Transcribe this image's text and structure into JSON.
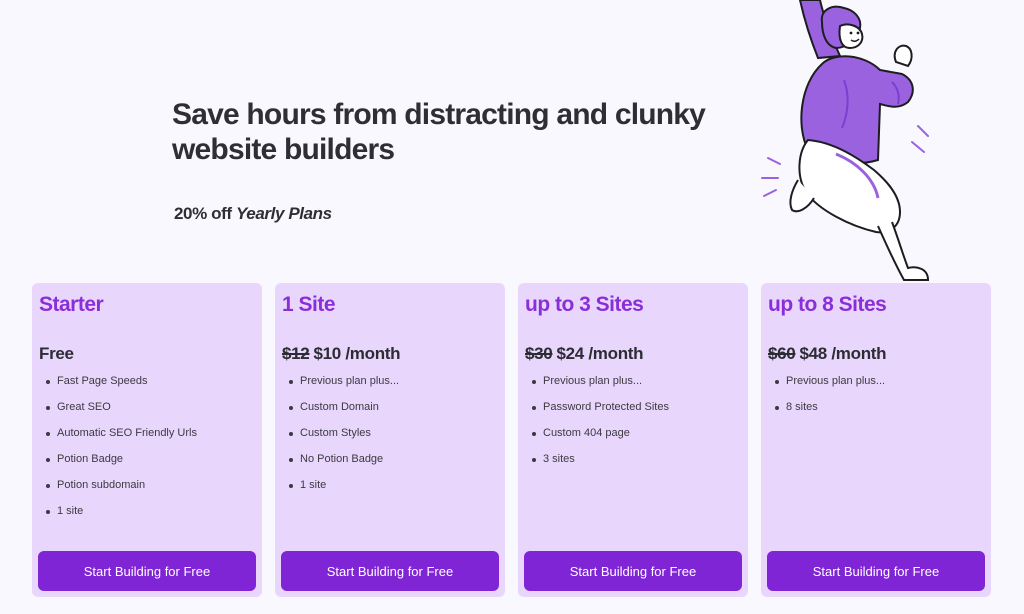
{
  "hero": {
    "title": "Save hours from distracting and clunky website builders",
    "promo_prefix": "20% off",
    "promo_italic": "Yearly Plans"
  },
  "colors": {
    "background": "#f9f8fe",
    "card_background": "#e9d6fd",
    "accent": "#8a2fd8",
    "button": "#7f25d6",
    "illustration_purple": "#9b62e0"
  },
  "plans": [
    {
      "title": "Starter",
      "price_old": "",
      "price_current": "Free",
      "price_period": "",
      "features": [
        "Fast Page Speeds",
        "Great SEO",
        "Automatic SEO Friendly Urls",
        "Potion Badge",
        "Potion subdomain",
        "1 site"
      ],
      "cta": "Start Building for Free"
    },
    {
      "title": "1 Site",
      "price_old": "$12",
      "price_current": "$10",
      "price_period": "/month",
      "features": [
        "Previous plan plus...",
        "Custom Domain",
        "Custom Styles",
        "No Potion Badge",
        "1 site"
      ],
      "cta": "Start Building for Free"
    },
    {
      "title": "up to 3 Sites",
      "price_old": "$30",
      "price_current": "$24",
      "price_period": "/month",
      "features": [
        "Previous plan plus...",
        "Password Protected Sites",
        "Custom 404 page",
        "3 sites"
      ],
      "cta": "Start Building for Free"
    },
    {
      "title": "up to 8 Sites",
      "price_old": "$60",
      "price_current": "$48",
      "price_period": "/month",
      "features": [
        "Previous plan plus...",
        "8 sites"
      ],
      "cta": "Start Building for Free"
    }
  ]
}
